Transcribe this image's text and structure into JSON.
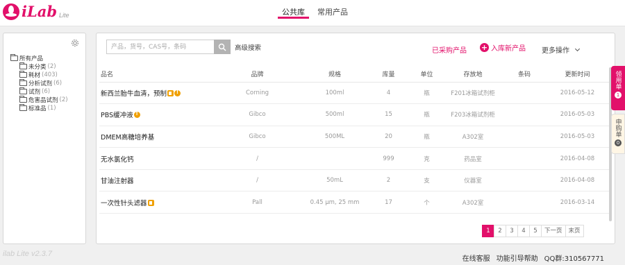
{
  "app": {
    "logo_text": "iLab",
    "logo_sub": "Lite",
    "version": "ilab Lite v2.3.7"
  },
  "colors": {
    "accent": "#e2106a",
    "badge": "#f0a000"
  },
  "tabs": [
    {
      "label": "公共库",
      "active": true
    },
    {
      "label": "常用产品",
      "active": false
    }
  ],
  "sidebar": {
    "settings_icon": "gear-icon",
    "root": {
      "label": "所有产品"
    },
    "items": [
      {
        "label": "未分类",
        "count": "(2)"
      },
      {
        "label": "耗材",
        "count": "(403)"
      },
      {
        "label": "分析试剂",
        "count": "(6)"
      },
      {
        "label": "试剂",
        "count": "(6)"
      },
      {
        "label": "危害品试剂",
        "count": "(2)"
      },
      {
        "label": "标准品",
        "count": "(1)"
      }
    ]
  },
  "toolbar": {
    "search_placeholder": "产品，货号，CAS号，条码",
    "advanced_search": "高级搜索",
    "purchased_products": "已采购产品",
    "add_product": "入库新产品",
    "more_actions": "更多操作"
  },
  "table": {
    "headers": {
      "name": "品名",
      "brand": "品牌",
      "spec": "规格",
      "stock": "库量",
      "unit": "单位",
      "location": "存放地",
      "barcode": "条码",
      "updated": "更新时间"
    },
    "rows": [
      {
        "name": "新西兰胎牛血清，预制",
        "brand": "Corning",
        "spec": "100ml",
        "stock": "4",
        "unit": "瓶",
        "location": "F201冰箱试剂柜",
        "barcode": "",
        "updated": "2016-05-12"
      },
      {
        "name": "PBS缓冲液",
        "brand": "Gibco",
        "spec": "500ml",
        "stock": "15",
        "unit": "瓶",
        "location": "F203冰箱试剂柜",
        "barcode": "",
        "updated": "2016-05-03"
      },
      {
        "name": "DMEM高糖培养基",
        "brand": "Gibco",
        "spec": "500ML",
        "stock": "20",
        "unit": "瓶",
        "location": "A302室",
        "barcode": "",
        "updated": "2016-05-03"
      },
      {
        "name": "无水氯化钙",
        "brand": "/",
        "spec": "",
        "stock": "999",
        "unit": "克",
        "location": "药品室",
        "barcode": "",
        "updated": "2016-04-08"
      },
      {
        "name": "甘油注射器",
        "brand": "/",
        "spec": "50mL",
        "stock": "2",
        "unit": "支",
        "location": "仪器室",
        "barcode": "",
        "updated": "2016-04-08"
      },
      {
        "name": "一次性针头滤器",
        "brand": "Pall",
        "spec": "0.45 μm, 25 mm",
        "stock": "17",
        "unit": "个",
        "location": "A302室",
        "barcode": "",
        "updated": "2016-03-14"
      }
    ]
  },
  "pagination": {
    "pages": [
      "1",
      "2",
      "3",
      "4",
      "5"
    ],
    "next": "下一页",
    "last": "末页",
    "current": "1"
  },
  "side_tabs": [
    {
      "label": "领用单",
      "count": "1"
    },
    {
      "label": "申购单",
      "count": "0"
    }
  ],
  "footer": {
    "links": [
      "在线客服",
      "功能引导帮助",
      "QQ群:310567771"
    ]
  }
}
